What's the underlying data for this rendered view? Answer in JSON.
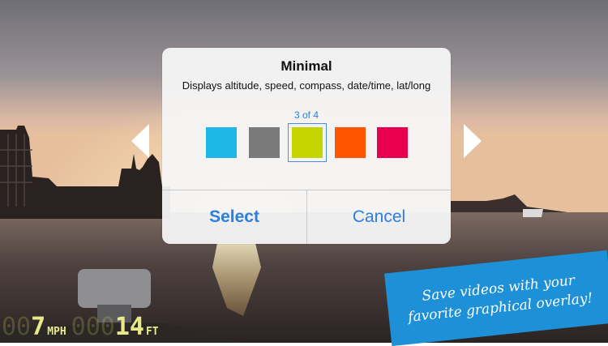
{
  "dialog": {
    "title": "Minimal",
    "description": "Displays altitude, speed, compass, date/time, lat/long",
    "counter": "3 of 4",
    "swatches": [
      "#1eb8e4",
      "#7a7a7a",
      "#c6d400",
      "#ff5400",
      "#e8004f"
    ],
    "selected_swatch": 3,
    "select_label": "Select",
    "cancel_label": "Cancel"
  },
  "hud": {
    "speed_dim": "00",
    "speed_value": "7",
    "speed_unit": "MPH",
    "altitude_dim": "000",
    "altitude_value": "14",
    "altitude_unit": "FT"
  },
  "promo": {
    "text": "Save videos with your favorite graphical overlay!"
  },
  "icons": {
    "prev": "chevron-left-icon",
    "next": "chevron-right-icon"
  }
}
